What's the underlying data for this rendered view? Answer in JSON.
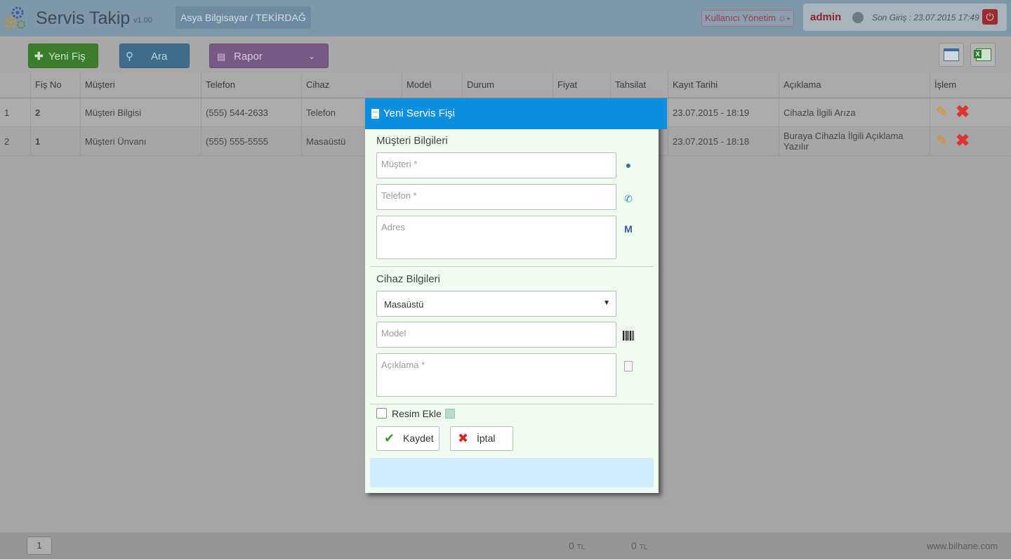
{
  "header": {
    "app_title": "Servis Takip",
    "version": "v1.00",
    "company": "Asya Bilgisayar / TEKİRDAĞ",
    "user_mgmt": "Kullanıcı Yönetim",
    "username": "admin",
    "last_login": "Son Giriş : 23.07.2015 17:49"
  },
  "toolbar": {
    "new_label": "Yeni Fiş",
    "search_label": "Ara",
    "report_label": "Rapor"
  },
  "table": {
    "columns": [
      "Fiş No",
      "Müşteri",
      "Telefon",
      "Cihaz",
      "Model",
      "Durum",
      "Fiyat",
      "Tahsilat",
      "Kayıt Tarihi",
      "Açıklama",
      "İşlem"
    ],
    "rows": [
      {
        "idx": "1",
        "no": "2",
        "customer": "Müşteri Bilgisi",
        "phone": "(555) 544-2633",
        "device": "Telefon",
        "date": "23.07.2015 - 18:19",
        "desc": "Cihazla İlgili Arıza"
      },
      {
        "idx": "2",
        "no": "1",
        "customer": "Müşteri Ünvanı",
        "phone": "(555) 555-5555",
        "device": "Masaüstü",
        "date": "23.07.2015 - 18:18",
        "desc": "Buraya Cihazla İlgili Açıklama Yazılır"
      }
    ]
  },
  "footer": {
    "page": "1",
    "total_price": "0",
    "total_paid": "0",
    "currency": "TL",
    "site": "www.bilhane.com"
  },
  "modal": {
    "title": "Yeni Servis Fişi",
    "customer_section": "Müşteri Bilgileri",
    "customer_placeholder": "Müşteri *",
    "phone_placeholder": "Telefon *",
    "address_placeholder": "Adres",
    "device_section": "Cihaz Bilgileri",
    "device_selected": "Masaüstü",
    "model_placeholder": "Model",
    "desc_placeholder": "Açıklama *",
    "image_label": "Resim Ekle",
    "save_label": "Kaydet",
    "cancel_label": "İptal"
  }
}
